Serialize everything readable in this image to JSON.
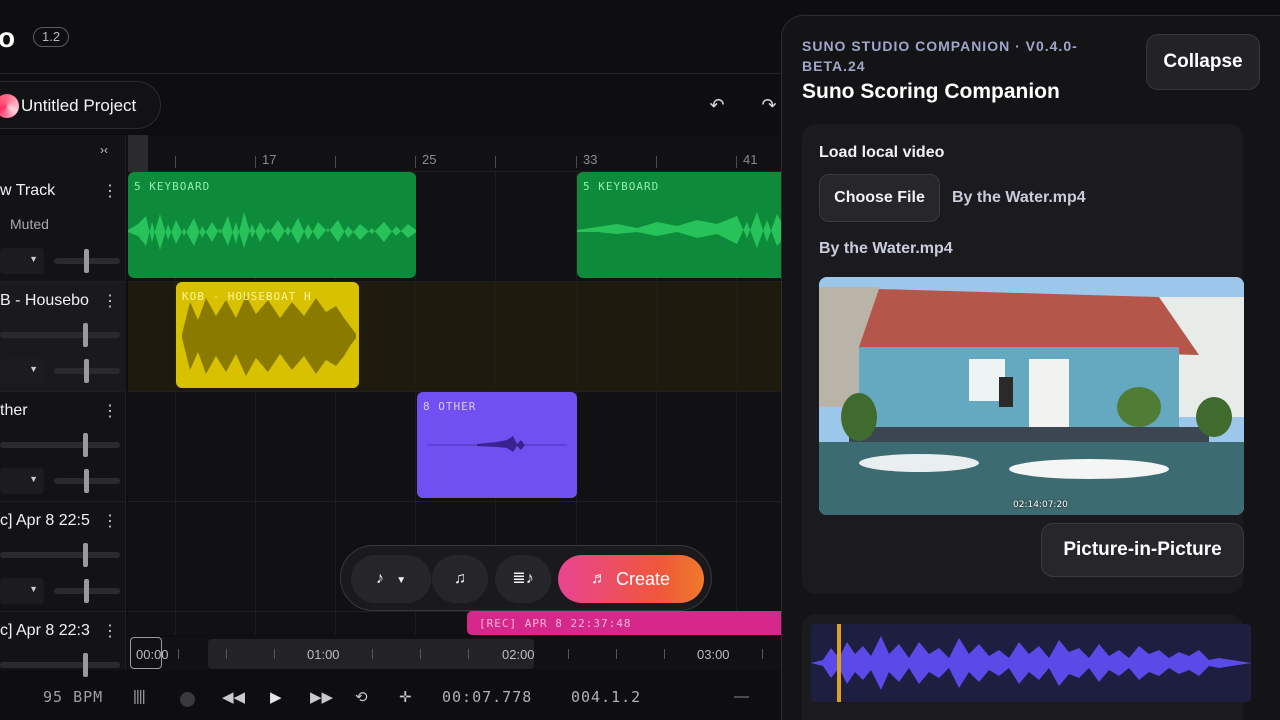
{
  "app": {
    "logo_fragment": "o",
    "version_badge": "1.2",
    "project_name": "Untitled Project"
  },
  "icons": {
    "undo": "undo-icon",
    "redo": "redo-icon",
    "collapse": "collapse-arrows-icon",
    "menu": "vertical-dots-icon"
  },
  "tracks": [
    {
      "name": "w Track",
      "sub": "Muted"
    },
    {
      "name": "B - Housebo",
      "sub": ""
    },
    {
      "name": "ther",
      "sub": ""
    },
    {
      "name": "c] Apr 8 22:5",
      "sub": ""
    },
    {
      "name": "c] Apr 8 22:3",
      "sub": ""
    }
  ],
  "ruler": {
    "labels": [
      "17",
      "25",
      "33",
      "41"
    ]
  },
  "clips": {
    "keyboard_a": "5 KEYBOARD",
    "keyboard_b": "5 KEYBOARD",
    "houseboat": "KOB - HOUSEBOAT H",
    "other": "8 OTHER",
    "rec": "[REC] APR 8 22:37:48"
  },
  "colors": {
    "keyboard": "#0d8a3a",
    "houseboat": "#d8c200",
    "other": "#7050f0",
    "rec": "#d6288a",
    "create_gradient_start": "#e84493",
    "create_gradient_end": "#f07a2a",
    "accent_wave": "#5a4ae8"
  },
  "create_bar": {
    "create_label": "Create"
  },
  "time_ruler": {
    "playhead": "00:00",
    "labels": [
      "01:00",
      "02:00",
      "03:00"
    ]
  },
  "transport": {
    "bpm": "95 BPM",
    "time": "00:07.778",
    "position": "004.1.2",
    "minus": "—"
  },
  "panel": {
    "kicker": "SUNO STUDIO COMPANION · V0.4.0-BETA.24",
    "title": "Suno Scoring Companion",
    "collapse_label": "Collapse",
    "load_heading": "Load local video",
    "choose_label": "Choose File",
    "chosen_file": "By the Water.mp4",
    "video_title": "By the Water.mp4",
    "video_timecode": "02:14:07:20",
    "pip_label": "Picture-in-Picture"
  }
}
